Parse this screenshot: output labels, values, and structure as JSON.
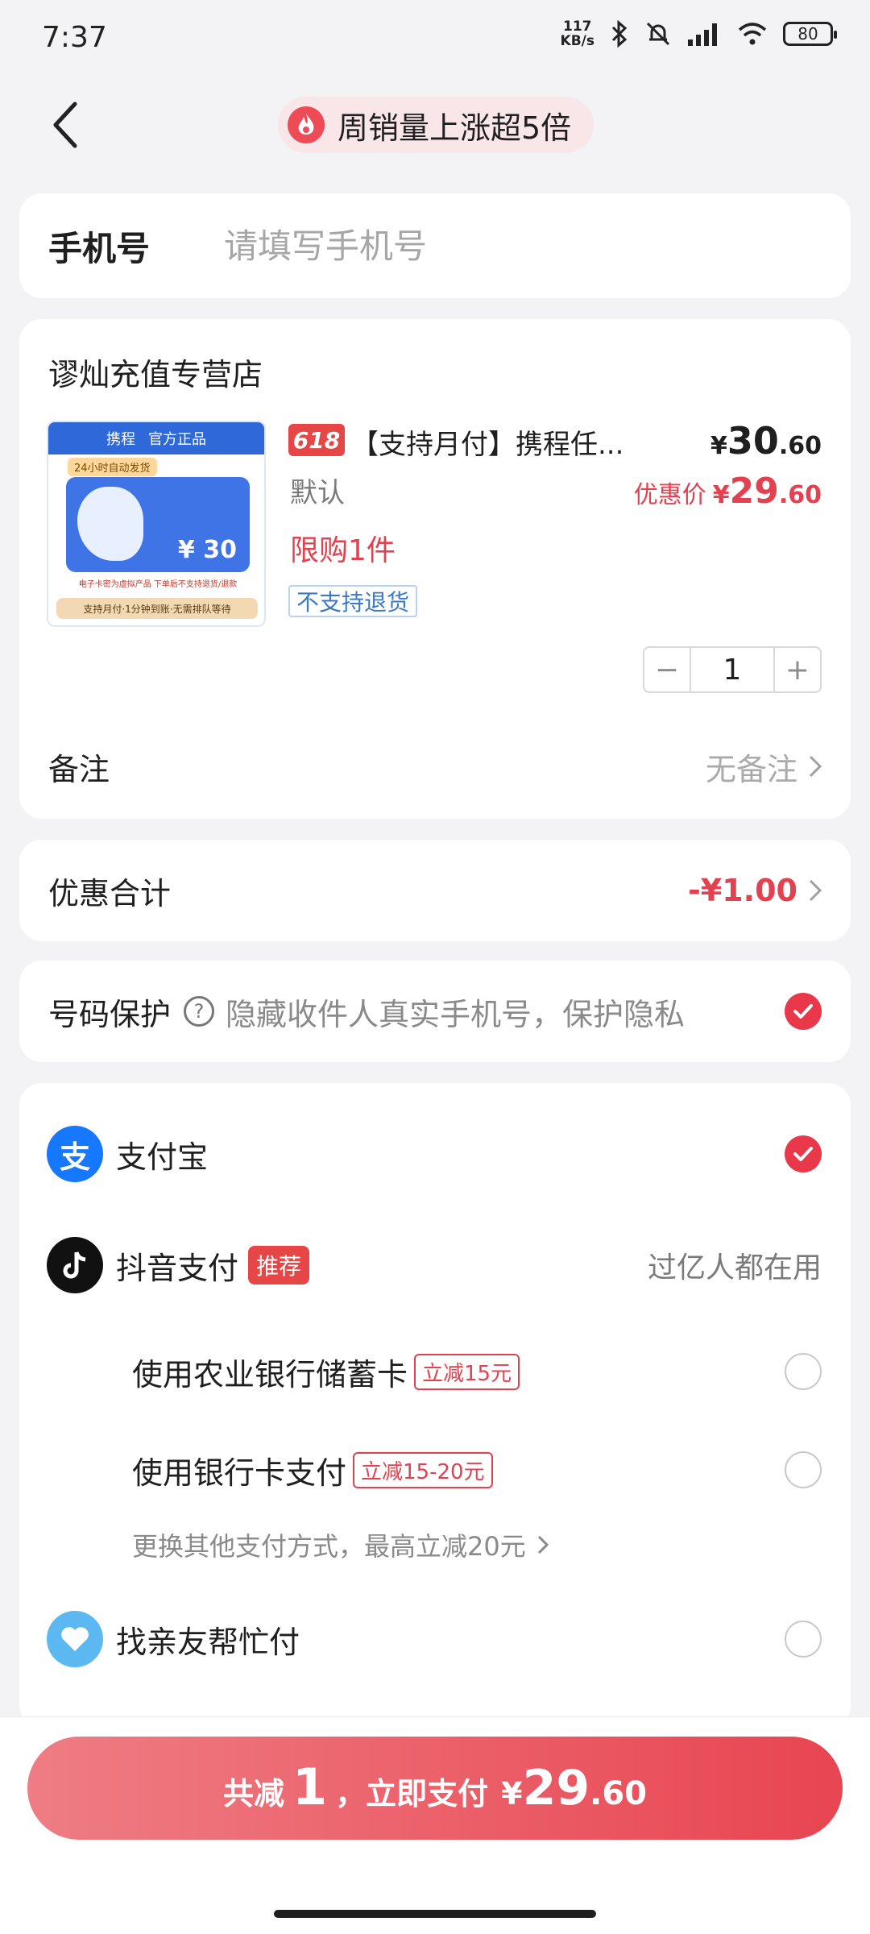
{
  "status": {
    "time": "7:37",
    "net_speed": "117",
    "net_unit": "KB/s",
    "battery": "80"
  },
  "header": {
    "promo": "周销量上涨超5倍"
  },
  "phone": {
    "label": "手机号",
    "placeholder": "请填写手机号"
  },
  "store": {
    "name": "谬灿充值专营店",
    "product": {
      "img_text_top_left": "携程",
      "img_text_top_right": "官方正品",
      "img_badge": "24小时自动发货",
      "img_value": "¥ 30",
      "img_note": "电子卡密为虚拟产品 下单后不支持退货/退款",
      "img_bottom": "支持月付·1分钟到账·无需排队等待",
      "tag": "618",
      "title": "【支持月付】携程任...",
      "price_symbol": "¥",
      "price_int": "30",
      "price_dec": ".60",
      "spec": "默认",
      "deal_label": "优惠价",
      "deal_symbol": "¥",
      "deal_int": "29",
      "deal_dec": ".60",
      "limit": "限购1件",
      "no_return": "不支持退货",
      "quantity": "1",
      "minus": "−",
      "plus": "+"
    },
    "remark_label": "备注",
    "remark_value": "无备注"
  },
  "discount": {
    "label": "优惠合计",
    "value": "-¥1.00"
  },
  "privacy": {
    "label": "号码保护",
    "text": "隐藏收件人真实手机号，保护隐私",
    "checked": true
  },
  "payment": {
    "alipay": {
      "name": "支付宝",
      "icon_text": "支"
    },
    "douyin": {
      "name": "抖音支付",
      "tag": "推荐",
      "note": "过亿人都在用"
    },
    "options": [
      {
        "name": "使用农业银行储蓄卡",
        "tag": "立减15元"
      },
      {
        "name": "使用银行卡支付",
        "tag": "立减15-20元"
      }
    ],
    "more": "更换其他支付方式，最高立减20元",
    "friend": {
      "name": "找亲友帮忙付"
    }
  },
  "pay_button": {
    "prefix": "共减",
    "count": "1",
    "middle": "，立即支付",
    "symbol": "¥",
    "int": "29",
    "dec": ".60"
  },
  "colors": {
    "accent": "#e8384a",
    "background": "#f3f3f5"
  }
}
